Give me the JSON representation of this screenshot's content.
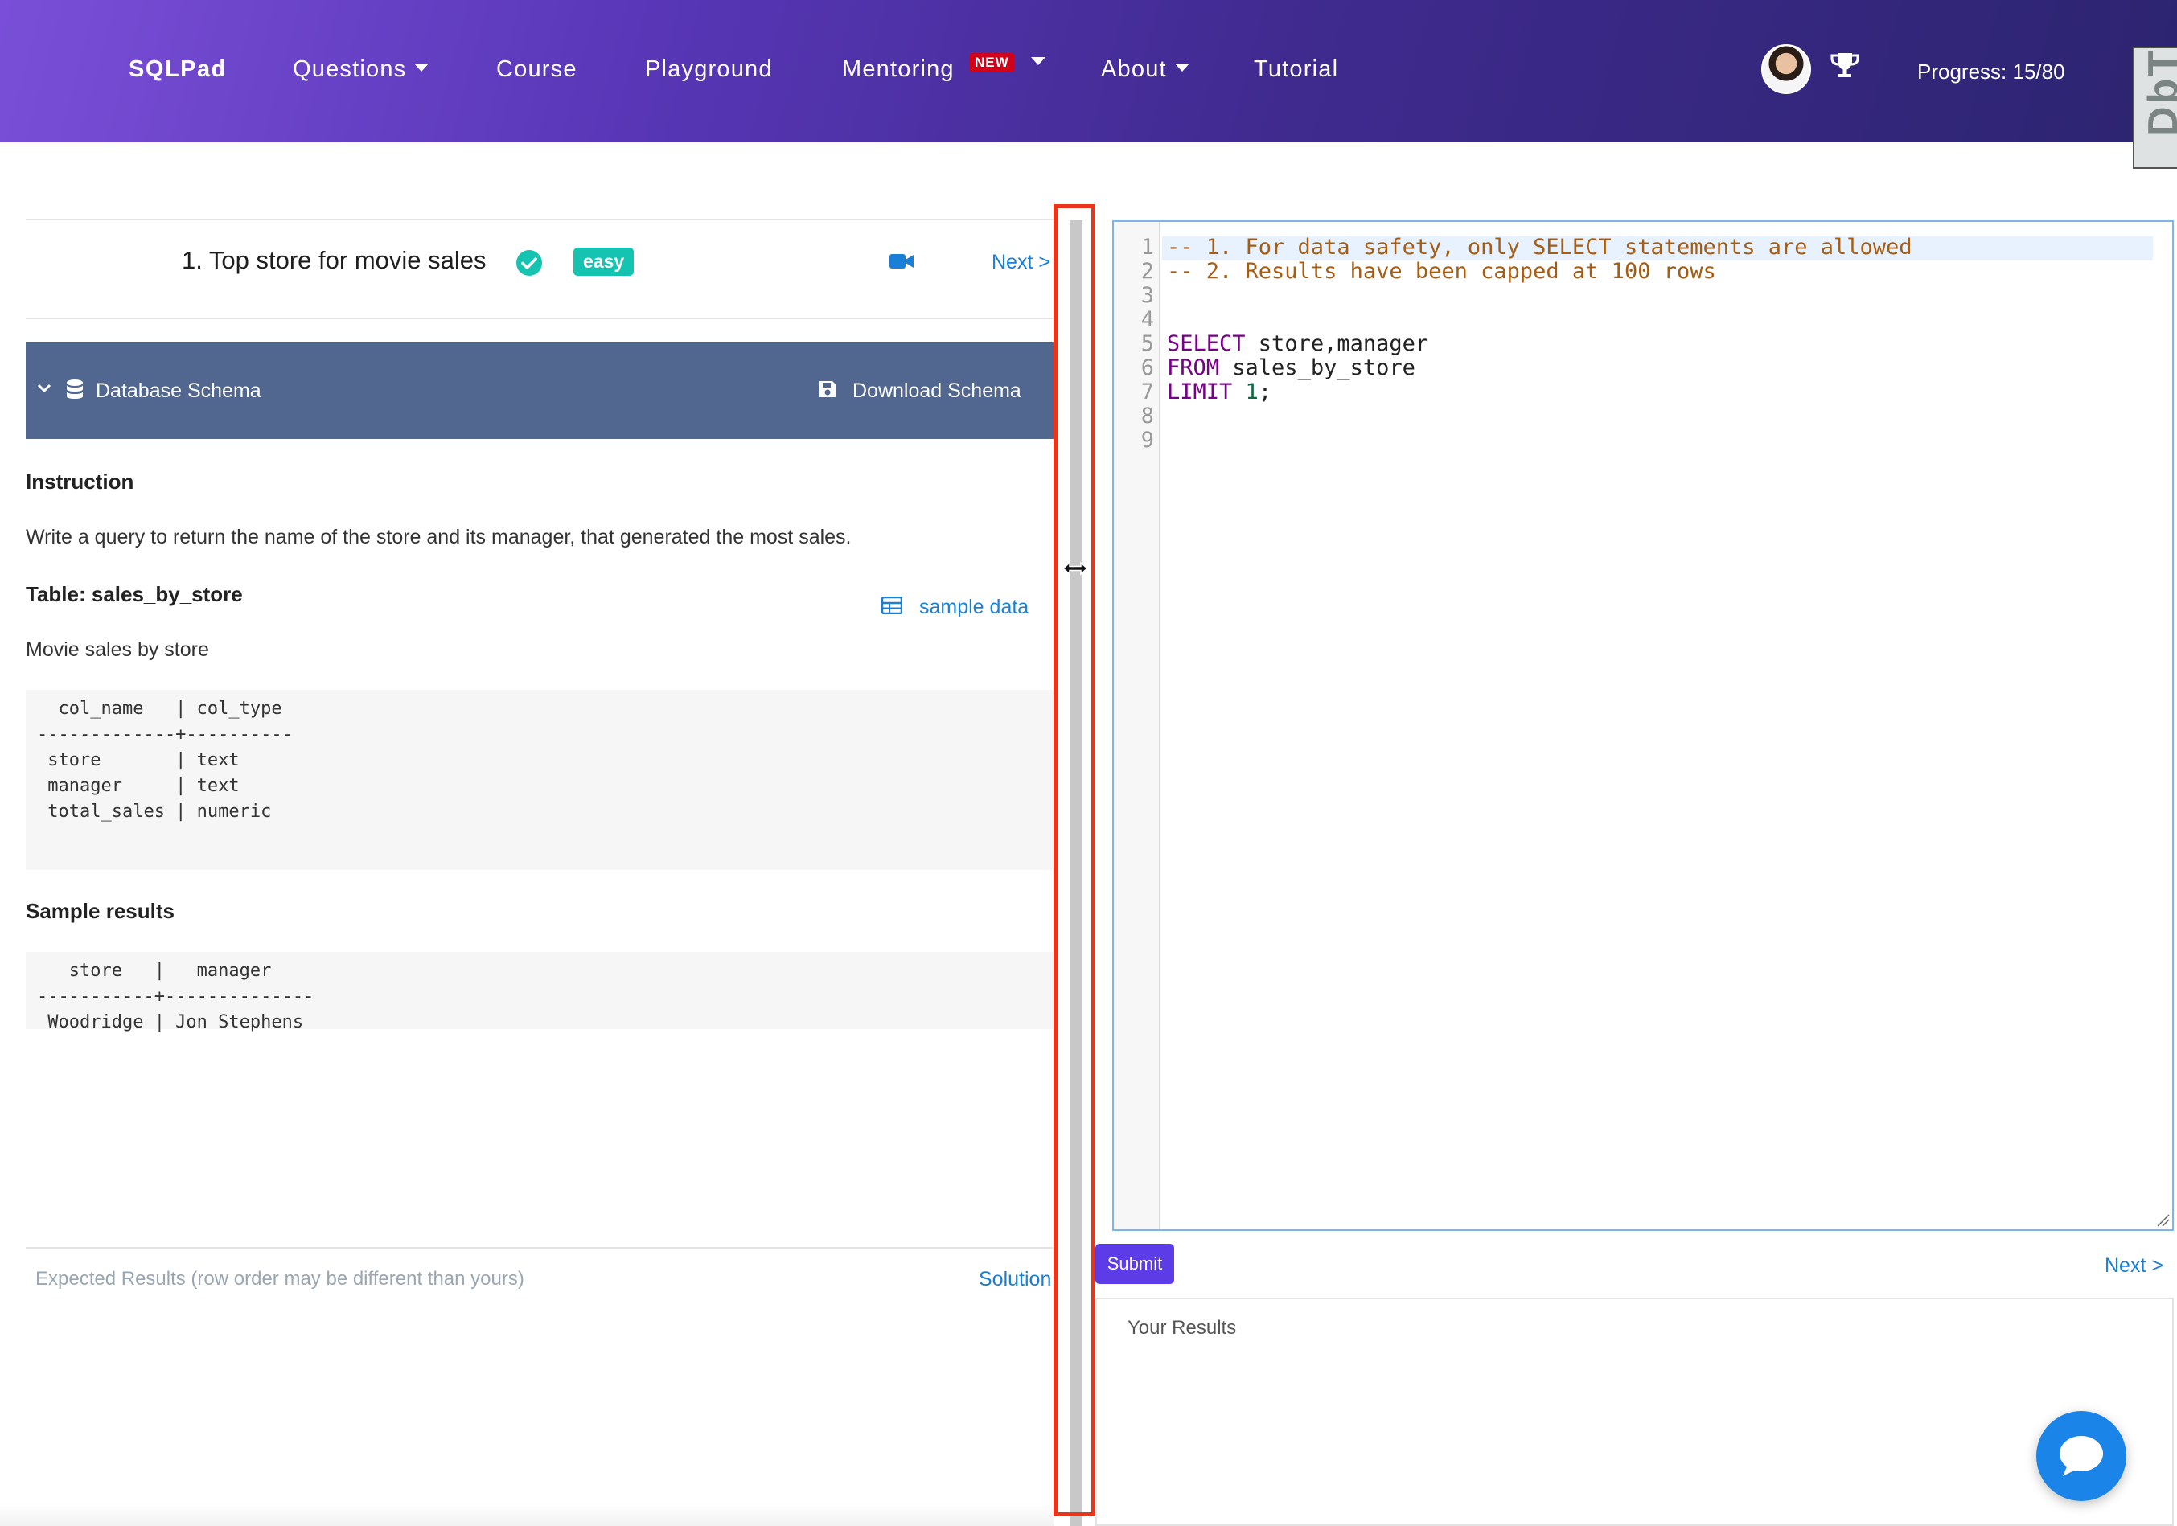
{
  "navbar": {
    "brand": "SQLPad",
    "items": [
      {
        "label": "Questions",
        "dropdown": true
      },
      {
        "label": "Course",
        "dropdown": false
      },
      {
        "label": "Playground",
        "dropdown": false
      },
      {
        "label": "Mentoring",
        "dropdown": true,
        "badge": "NEW"
      },
      {
        "label": "About",
        "dropdown": true
      },
      {
        "label": "Tutorial",
        "dropdown": false
      }
    ],
    "progress": "Progress: 15/80",
    "corner_text": "DbT"
  },
  "question": {
    "title": "1. Top store for movie sales",
    "difficulty": "easy",
    "status": "solved",
    "next_label": "Next >"
  },
  "schema_bar": {
    "label": "Database Schema",
    "download_label": "Download Schema"
  },
  "instruction": {
    "heading": "Instruction",
    "text": "Write a query to return the name of the store and its manager, that generated the most sales."
  },
  "table_info": {
    "heading": "Table: sales_by_store",
    "sample_data_label": "sample data",
    "description": "Movie sales by store",
    "schema_text": "  col_name   | col_type\n-------------+----------\n store       | text\n manager     | text\n total_sales | numeric"
  },
  "sample_results": {
    "heading": "Sample results",
    "text": "   store   |   manager\n-----------+--------------\n Woodridge | Jon Stephens"
  },
  "expected": {
    "label": "Expected Results (row order may be different than yours)",
    "solution_label": "Solution"
  },
  "editor": {
    "line_numbers": [
      "1",
      "2",
      "3",
      "4",
      "5",
      "6",
      "7",
      "8",
      "9"
    ],
    "line1": "-- 1. For data safety, only SELECT statements are allowed",
    "line2": "-- 2. Results have been capped at 100 rows",
    "l5_kw": "SELECT",
    "l5_rest": " store,manager",
    "l6_kw": "FROM",
    "l6_rest": " sales_by_store",
    "l7_kw": "LIMIT",
    "l7_num": "1",
    "l7_end": ";"
  },
  "actions": {
    "submit_label": "Submit",
    "next_label": "Next >",
    "results_label": "Your Results"
  },
  "colors": {
    "accent": "#5b3ce6",
    "schema_bar": "#526790",
    "easy": "#15c4b0",
    "link": "#1a7fd6",
    "splitter_highlight": "#e8351c"
  }
}
